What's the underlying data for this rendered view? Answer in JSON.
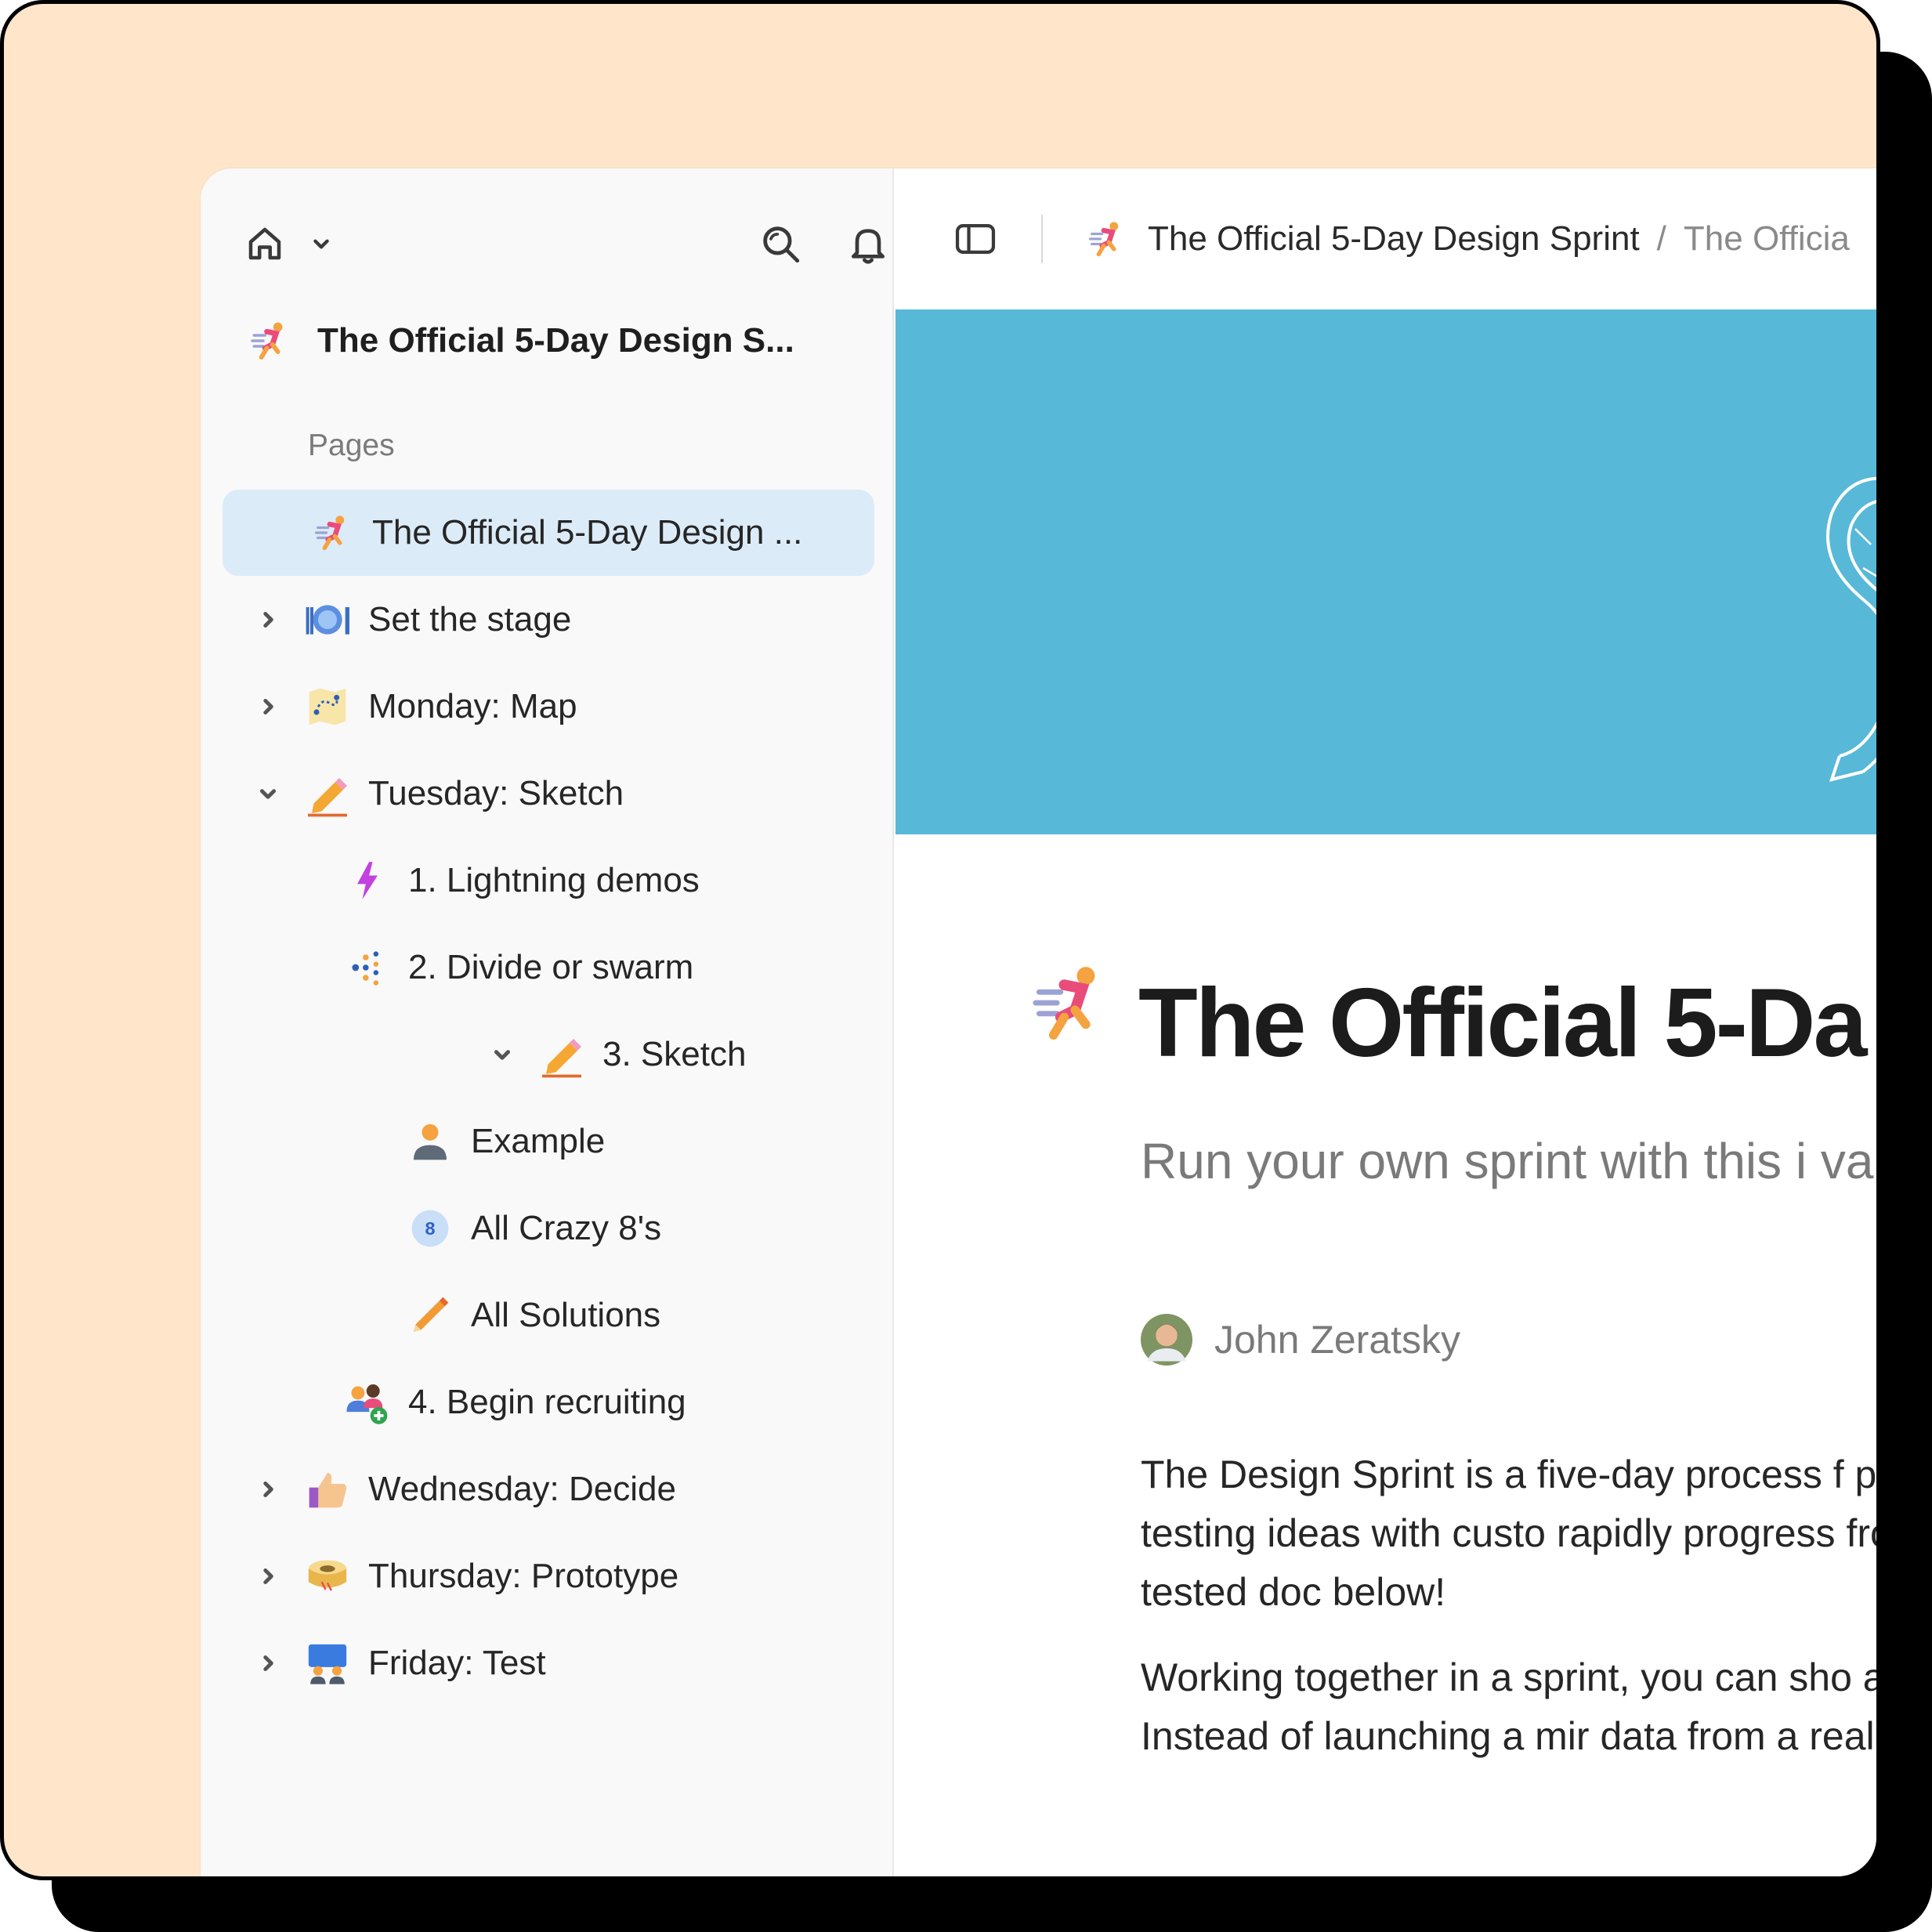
{
  "sidebar": {
    "workspace_title": "The Official 5-Day Design S...",
    "section_label": "Pages",
    "items": [
      {
        "label": "The Official 5-Day Design ...",
        "icon": "runner-icon"
      },
      {
        "label": "Set the stage",
        "icon": "plate-icon"
      },
      {
        "label": "Monday: Map",
        "icon": "map-icon"
      },
      {
        "label": "Tuesday: Sketch",
        "icon": "pencil-icon"
      },
      {
        "label": "1. Lightning demos",
        "icon": "lightning-icon"
      },
      {
        "label": "2. Divide or swarm",
        "icon": "swarm-icon"
      },
      {
        "label": "3. Sketch",
        "icon": "pencil-icon"
      },
      {
        "label": "Example",
        "icon": "person-icon"
      },
      {
        "label": "All Crazy 8's",
        "icon": "number-8-icon",
        "badge": "8"
      },
      {
        "label": "All Solutions",
        "icon": "pencil-icon"
      },
      {
        "label": "4. Begin recruiting",
        "icon": "add-people-icon"
      },
      {
        "label": "Wednesday: Decide",
        "icon": "thumbs-up-icon"
      },
      {
        "label": "Thursday: Prototype",
        "icon": "tape-icon"
      },
      {
        "label": "Friday: Test",
        "icon": "people-icon"
      }
    ]
  },
  "breadcrumb": {
    "first": "The Official 5-Day Design Sprint",
    "separator": "/",
    "second": "The Officia"
  },
  "page": {
    "title": "The Official 5-Da",
    "subtitle": "Run your own sprint with this i validation.",
    "author": "John Zeratsky",
    "paragraphs": [
      "The Design Sprint is a five-day process f prototyping, and testing ideas with custo rapidly progress from problem to tested doc below!",
      "Working together in a sprint, you can sho a single week. Instead of launching a mir data from a realistic prototype."
    ]
  },
  "colors": {
    "frame_bg": "#FFE6CA",
    "cover_bg": "#58B8D8",
    "selected_row": "#DCEBF8"
  }
}
